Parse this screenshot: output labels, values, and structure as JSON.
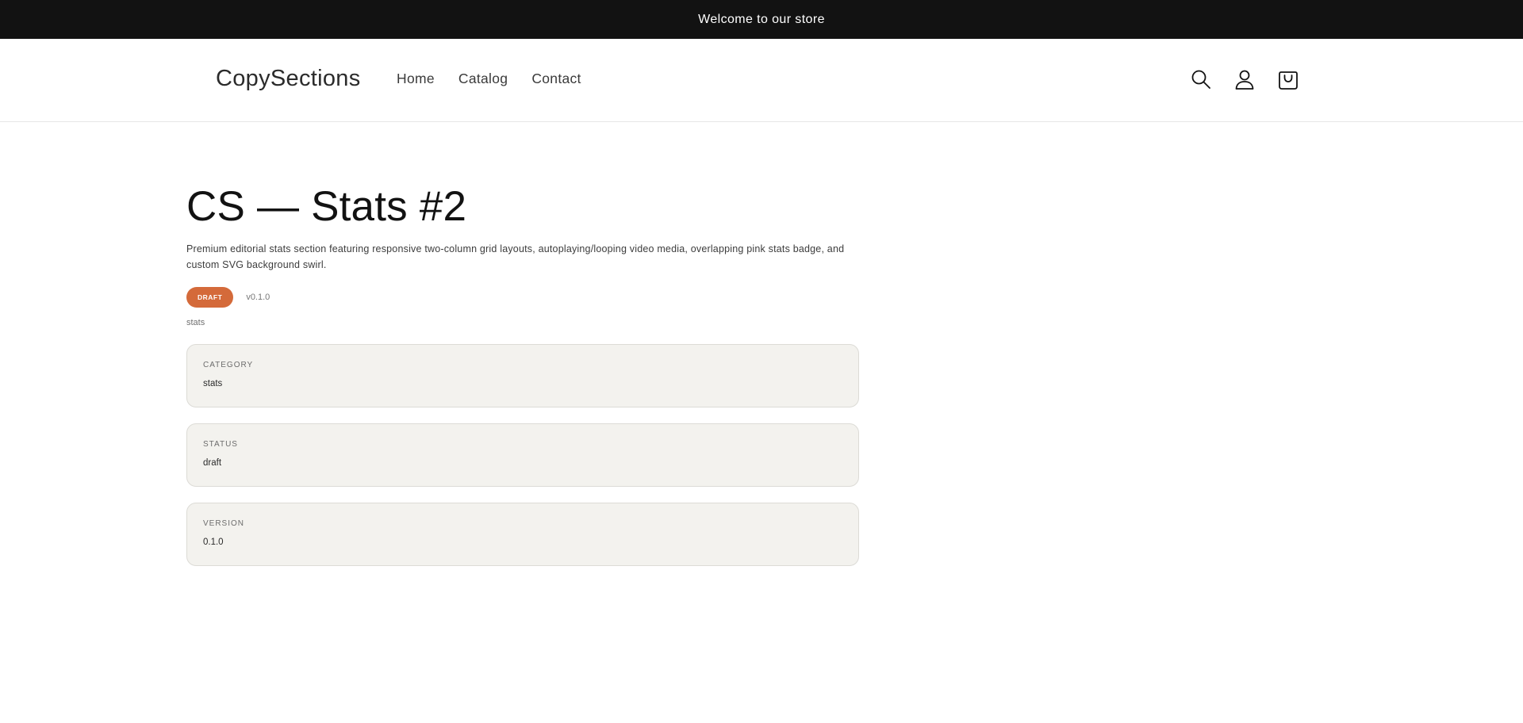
{
  "announcement": {
    "text": "Welcome to our store"
  },
  "header": {
    "logo": "CopySections",
    "nav": [
      "Home",
      "Catalog",
      "Contact"
    ],
    "icons": [
      "search-icon",
      "account-icon",
      "cart-icon"
    ]
  },
  "main": {
    "title": "CS — Stats #2",
    "description": "Premium editorial stats section featuring responsive two-column grid layouts, autoplaying/looping video media, overlapping pink stats badge, and custom SVG background swirl.",
    "badge": "DRAFT",
    "badge_color": "#d46a3a",
    "version_text": "v0.1.0",
    "tag": "stats",
    "cards": [
      {
        "label": "CATEGORY",
        "value": "stats"
      },
      {
        "label": "STATUS",
        "value": "draft"
      },
      {
        "label": "VERSION",
        "value": "0.1.0"
      }
    ]
  }
}
